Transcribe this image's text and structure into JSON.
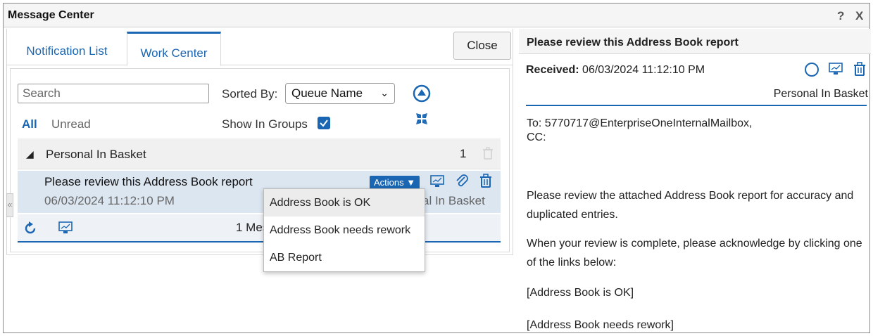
{
  "window": {
    "title": "Message Center",
    "help_label": "?",
    "close_label": "X"
  },
  "tabs": {
    "notification_list": "Notification List",
    "work_center": "Work Center"
  },
  "toolbar": {
    "close_label": "Close",
    "search_placeholder": "Search",
    "sorted_by_label": "Sorted By:",
    "sort_value": "Queue Name",
    "filter_all": "All",
    "filter_unread": "Unread",
    "show_in_groups_label": "Show In Groups",
    "show_in_groups_checked": true
  },
  "group": {
    "title": "Personal In Basket",
    "count": "1"
  },
  "message": {
    "subject": "Please review this Address Book report",
    "date": "06/03/2024 11:12:10 PM",
    "basket_partial": "al In Basket",
    "actions_label": "Actions"
  },
  "footer": {
    "count_text": "1 Mess"
  },
  "actions_menu": {
    "items": [
      "Address Book is OK",
      "Address Book needs rework",
      "AB Report"
    ]
  },
  "detail": {
    "title": "Please review this Address Book report",
    "received_label": "Received:",
    "received_value": "06/03/2024 11:12:10 PM",
    "basket": "Personal In Basket",
    "to": "To: 5770717@EnterpriseOneInternalMailbox,",
    "cc": "CC:",
    "body_paragraph1": "Please review the attached Address Book report for accuracy and duplicated entries.",
    "body_paragraph2": "When your review is complete, please acknowledge by clicking one of the links below:",
    "link1": "[Address Book is OK]",
    "link2": "[Address Book needs rework]"
  },
  "colors": {
    "accent": "#1a66b3",
    "selected_row": "#dce6f1",
    "group_header": "#f0f0f0"
  }
}
